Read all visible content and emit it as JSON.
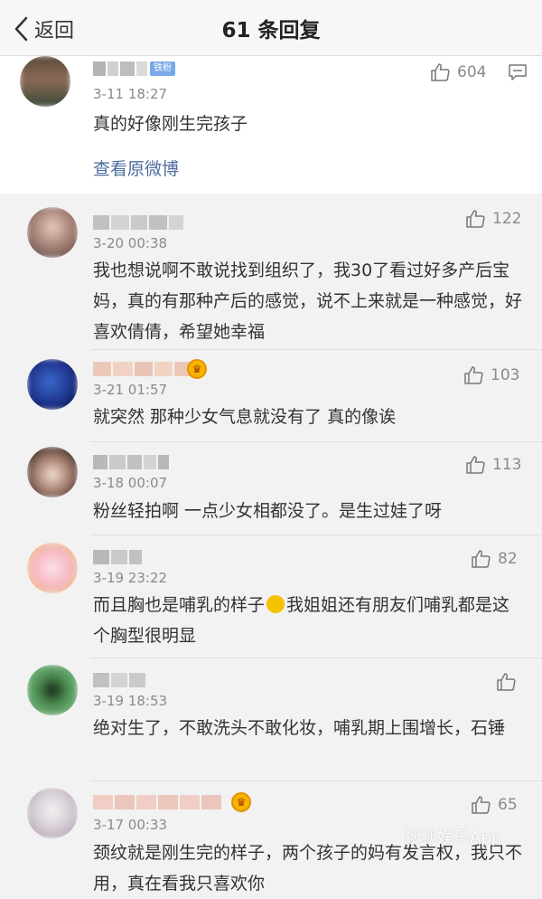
{
  "nav": {
    "back_label": "返回",
    "title": "61 条回复"
  },
  "main": {
    "badge": "铁粉",
    "time": "3-11 18:27",
    "likes": "604",
    "text": "真的好像刚生完孩子",
    "view_original": "查看原微博"
  },
  "replies": [
    {
      "time": "3-20 00:38",
      "likes": "122",
      "text": "我也想说啊不敢说找到组织了，我30了看过好多产后宝妈，真的有那种产后的感觉，说不上来就是一种感觉，好喜欢倩倩，希望她幸福"
    },
    {
      "time": "3-21 01:57",
      "likes": "103",
      "text": "就突然 那种少女气息就没有了 真的像诶"
    },
    {
      "time": "3-18 00:07",
      "likes": "113",
      "text": "粉丝轻拍啊 一点少女相都没了。是生过娃了呀"
    },
    {
      "time": "3-19 23:22",
      "likes": "82",
      "text_before": "而且胸也是哺乳的样子",
      "text_after": "我姐姐还有朋友们哺乳都是这个胸型很明显"
    },
    {
      "time": "3-19 18:53",
      "likes": "",
      "text": "绝对生了，不敢洗头不敢化妆，哺乳期上围增长，石锤"
    },
    {
      "time": "3-17 00:33",
      "likes": "65",
      "text": "颈纹就是刚生完的样子，两个孩子的妈有发言权，我只不用，真在看我只喜欢你"
    }
  ],
  "watermark": "搜狐娱乐App",
  "colors": {
    "link": "#4e6ea0",
    "badge": "#7aa8e8",
    "muted": "#8a8a8a"
  }
}
